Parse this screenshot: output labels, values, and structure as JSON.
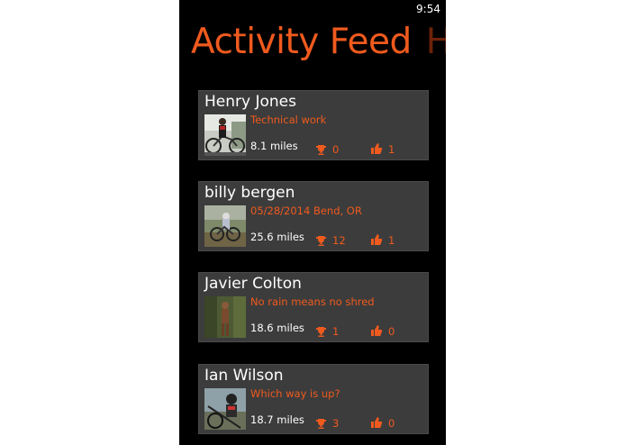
{
  "status": {
    "time": "9:54"
  },
  "header": {
    "title": "Activity Feed",
    "next_title": "H"
  },
  "feed": [
    {
      "name": "Henry Jones",
      "description": "Technical work",
      "distance": "8.1 miles",
      "trophies": "0",
      "likes": "1"
    },
    {
      "name": "billy  bergen",
      "description": "05/28/2014 Bend, OR",
      "distance": "25.6 miles",
      "trophies": "12",
      "likes": "1"
    },
    {
      "name": "Javier Colton",
      "description": "No rain means no shred",
      "distance": "18.6 miles",
      "trophies": "1",
      "likes": "0"
    },
    {
      "name": "Ian Wilson",
      "description": "Which way is up?",
      "distance": "18.7 miles",
      "trophies": "3",
      "likes": "0"
    }
  ],
  "colors": {
    "accent": "#f05a1e",
    "card": "#3c3c3c",
    "background": "#000000"
  },
  "icons": {
    "trophy": "trophy-icon",
    "like": "thumbs-up-icon"
  }
}
